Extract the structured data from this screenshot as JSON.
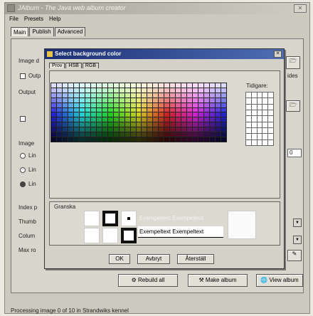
{
  "window": {
    "title": "JAlbum - The Java web album creator"
  },
  "menu": [
    "File",
    "Presets",
    "Help"
  ],
  "tabs": [
    "Main",
    "Publish",
    "Advanced"
  ],
  "main": {
    "image_dir_label": "Image d",
    "output_check_label": "Outp",
    "output_label": "Output",
    "output_suffix": "ides",
    "image_label": "Image",
    "radio1": "Lin",
    "radio2": "Lin",
    "radio3": "Lin",
    "value_field": "0",
    "index_label": "Index p",
    "thumbs_label": "Thumb",
    "columns_label": "Colum",
    "maxrows_label": "Max ro"
  },
  "buttons": {
    "rebuild": "Rebuild all",
    "make_album": "Make album",
    "view_album": "View album"
  },
  "status": "Processing image 0 of 10 in Strandwiks kennel",
  "dialog": {
    "title": "Select background color",
    "tabs": [
      "Prov",
      "HSB",
      "RGB"
    ],
    "recent_label": "Tidigare:",
    "preview_label": "Granska",
    "preview_text_light": "Exempeltext  Exempeltext",
    "preview_text_dark": "Exempeltext  Exempeltext",
    "ok": "OK",
    "cancel": "Avbryt",
    "reset": "Återställ"
  }
}
